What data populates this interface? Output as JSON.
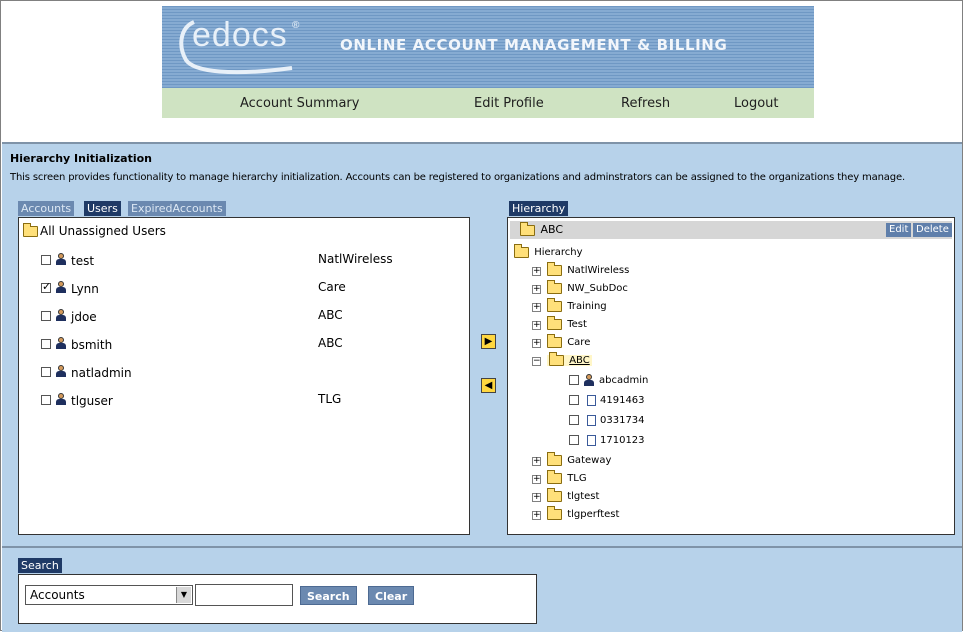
{
  "header": {
    "logo_text": "edocs",
    "logo_registered": "®",
    "app_title": "ONLINE ACCOUNT MANAGEMENT & BILLING",
    "nav": [
      {
        "label": "Account Summary"
      },
      {
        "label": "Edit Profile"
      },
      {
        "label": "Refresh"
      },
      {
        "label": "Logout"
      }
    ]
  },
  "section": {
    "title": "Hierarchy Initialization",
    "description": "This screen provides functionality to manage hierarchy initialization. Accounts can be registered to organizations and adminstrators can be assigned to the organizations they manage."
  },
  "left_tabs": [
    {
      "label": "Accounts",
      "active": false
    },
    {
      "label": "Users",
      "active": true
    },
    {
      "label": "ExpiredAccounts",
      "active": false
    }
  ],
  "users_panel": {
    "header": "All Unassigned Users",
    "users": [
      {
        "name": "test",
        "org": "NatlWireless",
        "checked": false
      },
      {
        "name": "Lynn",
        "org": "Care",
        "checked": true
      },
      {
        "name": "jdoe",
        "org": "ABC",
        "checked": false
      },
      {
        "name": "bsmith",
        "org": "ABC",
        "checked": false
      },
      {
        "name": "natladmin",
        "org": "",
        "checked": false
      },
      {
        "name": "tlguser",
        "org": "TLG",
        "checked": false
      }
    ]
  },
  "move_buttons": {
    "assign": "▶",
    "unassign": "◀"
  },
  "hierarchy": {
    "tab_label": "Hierarchy",
    "selected": "ABC",
    "edit_label": "Edit",
    "delete_label": "Delete",
    "root": "Hierarchy",
    "nodes": [
      {
        "label": "NatlWireless",
        "expander": "+"
      },
      {
        "label": "NW_SubDoc",
        "expander": "+"
      },
      {
        "label": "Training",
        "expander": "+"
      },
      {
        "label": "Test",
        "expander": "+"
      },
      {
        "label": "Care",
        "expander": "+"
      },
      {
        "label": "ABC",
        "expander": "−"
      },
      {
        "label": "Gateway",
        "expander": "+"
      },
      {
        "label": "TLG",
        "expander": "+"
      },
      {
        "label": "tlgtest",
        "expander": "+"
      },
      {
        "label": "tlgperftest",
        "expander": "+"
      }
    ],
    "abc_children": [
      {
        "label": "abcadmin",
        "type": "user"
      },
      {
        "label": "4191463",
        "type": "doc"
      },
      {
        "label": "0331734",
        "type": "doc"
      },
      {
        "label": "1710123",
        "type": "doc"
      }
    ]
  },
  "search": {
    "tab_label": "Search",
    "select_value": "Accounts",
    "input_value": "",
    "search_label": "Search",
    "clear_label": "Clear"
  },
  "colors": {
    "panel_bg": "#b7d2ea",
    "tab_active": "#1f3a66",
    "tab_inactive": "#6b89b0",
    "nav_bg": "#cfe3c2"
  }
}
